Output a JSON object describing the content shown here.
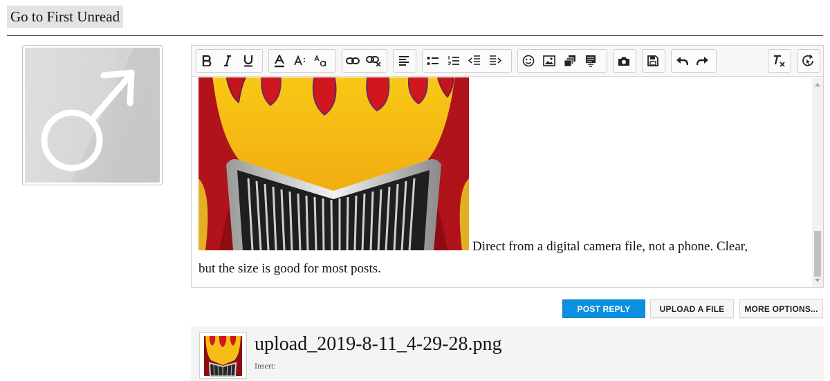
{
  "thread": {
    "go_to_first_unread": "Go to First Unread"
  },
  "avatar": {
    "icon": "male-symbol-icon"
  },
  "toolbar": {
    "groups": [
      [
        "bold-icon",
        "italic-icon",
        "underline-icon"
      ],
      [
        "text-color-icon",
        "font-size-icon",
        "font-family-icon"
      ],
      [
        "link-icon",
        "unlink-icon"
      ],
      [
        "align-left-icon"
      ],
      [
        "bulleted-list-icon",
        "numbered-list-icon",
        "outdent-icon",
        "indent-icon"
      ],
      [
        "smilie-icon",
        "image-icon",
        "media-icon",
        "quote-icon"
      ],
      [
        "camera-icon"
      ],
      [
        "save-draft-icon"
      ],
      [
        "undo-icon",
        "redo-icon"
      ],
      [
        "remove-formatting-icon"
      ],
      [
        "toggle-bbcode-icon"
      ]
    ]
  },
  "editor": {
    "text_line1": "Direct from a digital camera file, not a phone.  Clear,",
    "text_line2": "but the size is good for most posts."
  },
  "actions": {
    "post_reply": "Post Reply",
    "upload_file": "Upload a File",
    "more_options": "More Options..."
  },
  "attachment": {
    "filename": "upload_2019-8-11_4-29-28.png",
    "insert_label": "Insert:"
  },
  "colors": {
    "accent": "#0990e0",
    "hot_rod_yellow": "#f6c21a",
    "flame_red": "#c8141a"
  }
}
